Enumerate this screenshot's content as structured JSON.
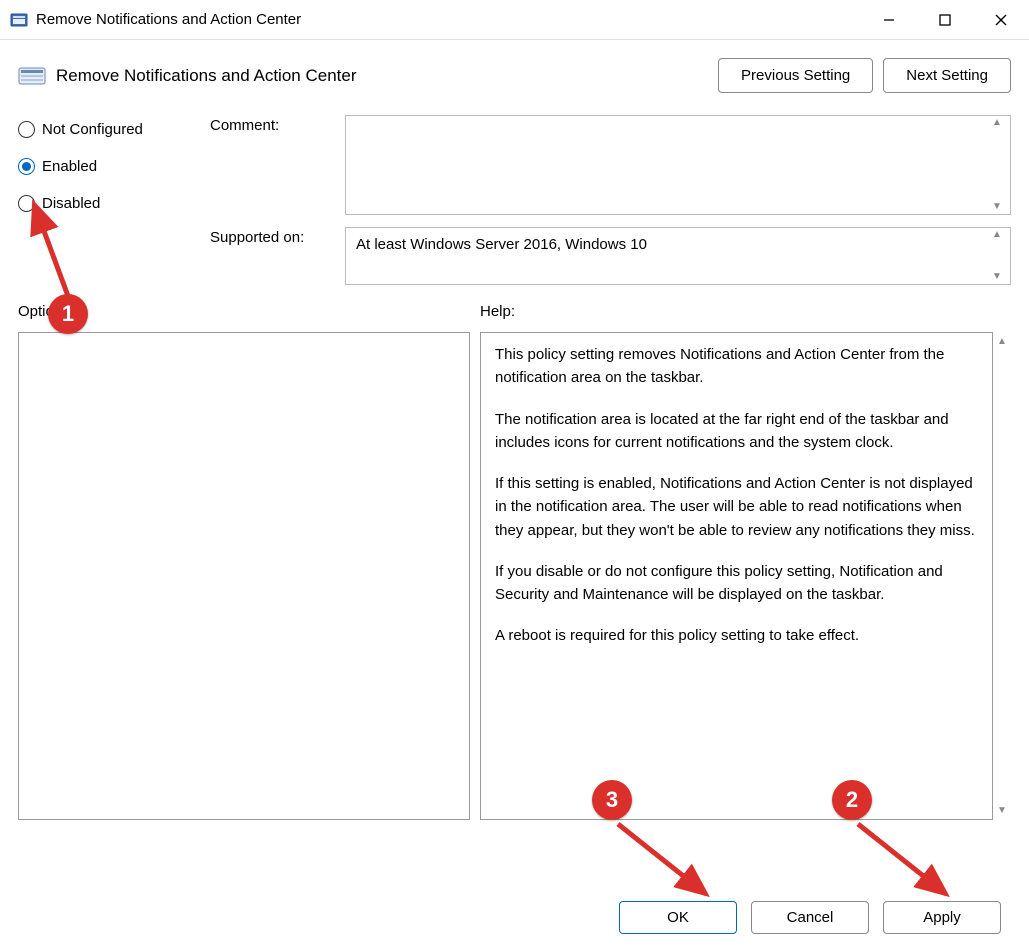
{
  "window": {
    "title": "Remove Notifications and Action Center"
  },
  "header": {
    "title": "Remove Notifications and Action Center",
    "prev_label": "Previous Setting",
    "next_label": "Next Setting"
  },
  "radios": {
    "not_configured": "Not Configured",
    "enabled": "Enabled",
    "disabled": "Disabled",
    "selected": "enabled"
  },
  "fields": {
    "comment_label": "Comment:",
    "comment_value": "",
    "supported_label": "Supported on:",
    "supported_value": "At least Windows Server 2016, Windows 10"
  },
  "panels": {
    "options_label": "Options:",
    "help_label": "Help:"
  },
  "help_paragraphs": [
    "This policy setting removes Notifications and Action Center from the notification area on the taskbar.",
    "The notification area is located at the far right end of the taskbar and includes icons for current notifications and the system clock.",
    "If this setting is enabled, Notifications and Action Center is not displayed in the notification area. The user will be able to read notifications when they appear, but they won't be able to review any notifications they miss.",
    "If you disable or do not configure this policy setting, Notification and Security and Maintenance will be displayed on the taskbar.",
    "A reboot is required for this policy setting to take effect."
  ],
  "footer": {
    "ok": "OK",
    "cancel": "Cancel",
    "apply": "Apply"
  },
  "annotations": {
    "b1": "1",
    "b2": "2",
    "b3": "3"
  }
}
